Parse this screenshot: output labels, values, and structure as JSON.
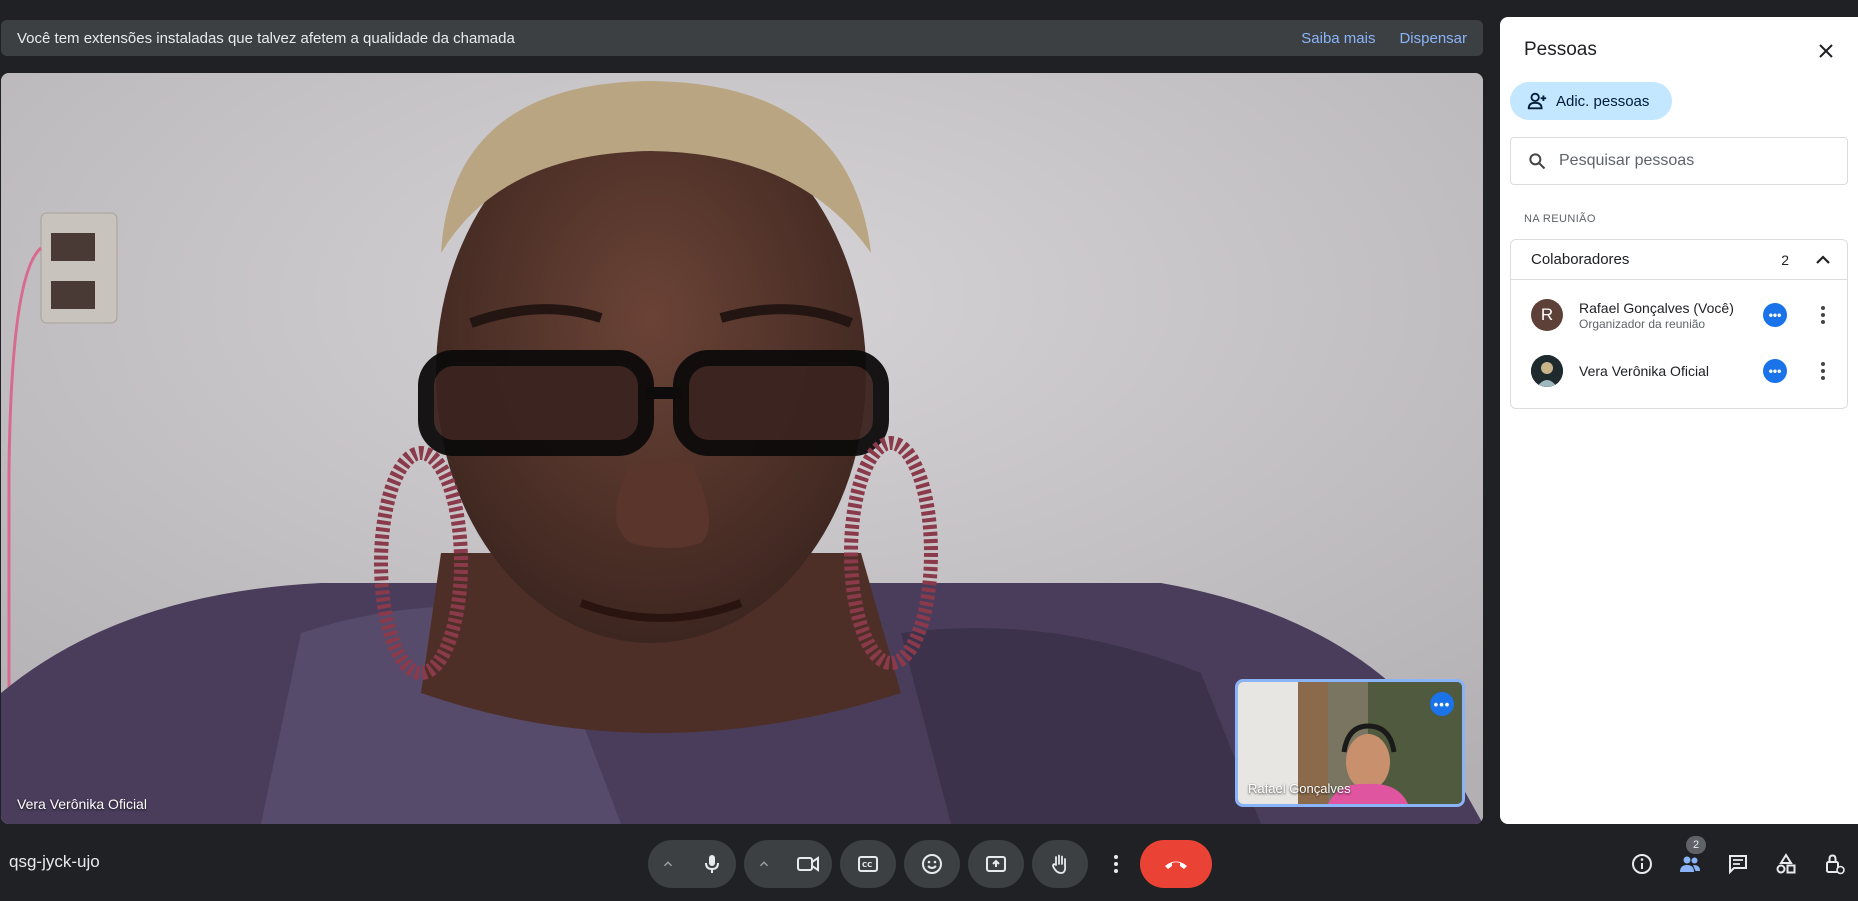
{
  "banner": {
    "message": "Você tem extensões instaladas que talvez afetem a qualidade da chamada",
    "learn_more": "Saiba mais",
    "dismiss": "Dispensar"
  },
  "main_video": {
    "participant_name": "Vera Verônika Oficial"
  },
  "self_view": {
    "participant_name": "Rafael Gonçalves"
  },
  "panel": {
    "title": "Pessoas",
    "add_people_label": "Adic. pessoas",
    "search_placeholder": "Pesquisar pessoas",
    "section_label": "NA REUNIÃO",
    "group": {
      "title": "Colaboradores",
      "count": "2"
    },
    "people": [
      {
        "name": "Rafael Gonçalves (Você)",
        "role": "Organizador da reunião",
        "initial": "R"
      },
      {
        "name": "Vera Verônika Oficial",
        "role": "",
        "initial": ""
      }
    ]
  },
  "meeting": {
    "code": "qsg-jyck-ujo"
  },
  "toolbar": {
    "people_count": "2"
  },
  "colors": {
    "accent_blue": "#1a73e8",
    "hangup_red": "#ea4335",
    "panel_add_button": "#c2e7ff",
    "bar_background": "#202124"
  },
  "icons": [
    "close-icon",
    "add-person-icon",
    "search-icon",
    "chevron-up-icon",
    "more-vert-icon",
    "mic-icon",
    "camera-icon",
    "captions-icon",
    "emoji-icon",
    "present-icon",
    "hand-icon",
    "hangup-icon",
    "info-icon",
    "people-icon",
    "chat-icon",
    "activities-icon",
    "host-controls-icon"
  ]
}
